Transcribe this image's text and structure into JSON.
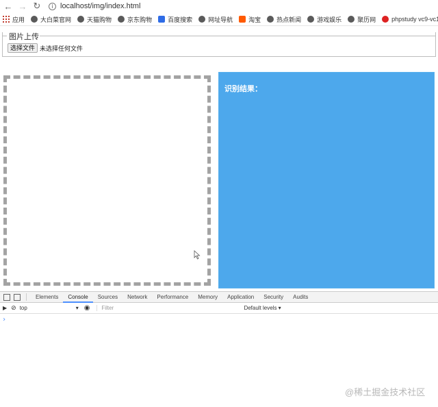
{
  "browser": {
    "url": "localhost/img/index.html",
    "bookmarks": [
      {
        "label": "应用",
        "icon": "apps-icon"
      },
      {
        "label": "大白菜官网",
        "icon": "globe-icon"
      },
      {
        "label": "天猫购物",
        "icon": "globe-icon"
      },
      {
        "label": "京东购物",
        "icon": "globe-icon"
      },
      {
        "label": "百度搜索",
        "icon": "baidu-icon"
      },
      {
        "label": "网址导航",
        "icon": "globe-icon"
      },
      {
        "label": "淘宝",
        "icon": "taobao-icon"
      },
      {
        "label": "热点新闻",
        "icon": "globe-icon"
      },
      {
        "label": "游戏娱乐",
        "icon": "globe-icon"
      },
      {
        "label": "聚历网",
        "icon": "globe-icon"
      },
      {
        "label": "phpstudy vc9-vc1...",
        "icon": "php-icon"
      }
    ]
  },
  "upload": {
    "legend": "图片上传",
    "button_label": "选择文件",
    "status": "未选择任何文件"
  },
  "result": {
    "label": "识别结果："
  },
  "devtools": {
    "tabs": [
      "Elements",
      "Console",
      "Sources",
      "Network",
      "Performance",
      "Memory",
      "Application",
      "Security",
      "Audits"
    ],
    "active_tab": "Console",
    "context": "top",
    "filter_placeholder": "Filter",
    "levels": "Default levels ▾",
    "prompt": "›"
  },
  "watermark": "@稀土掘金技术社区",
  "colors": {
    "result_bg": "#4da8ec",
    "dash_border": "#a3a3a3",
    "active_tab_accent": "#4d90fe"
  }
}
